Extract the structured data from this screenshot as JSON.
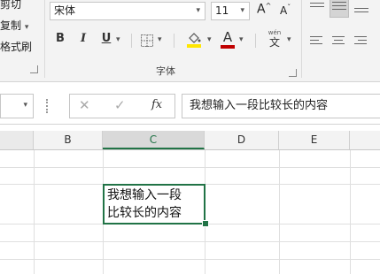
{
  "clipboard": {
    "items": [
      "剪切",
      "复制",
      "格式刷"
    ]
  },
  "font_group": {
    "font_name": "宋体",
    "font_size": "11",
    "grow_label": "A",
    "shrink_label": "A",
    "bold": "B",
    "italic": "I",
    "underline": "U",
    "font_color_letter": "A",
    "font_color": "#c00000",
    "highlight_color": "#ffe600",
    "phonetic_label": "wén",
    "phonetic_char": "文",
    "group_label": "字体"
  },
  "formula_bar": {
    "name_box": "",
    "cancel": "✕",
    "enter": "✓",
    "fx": "fx",
    "content": "我想输入一段比较长的内容"
  },
  "columns": [
    "B",
    "C",
    "D",
    "E"
  ],
  "selected_column": "C",
  "cell": {
    "line1": "我想输入一段",
    "line2": "比较长的内容"
  },
  "accent_color": "#217346"
}
